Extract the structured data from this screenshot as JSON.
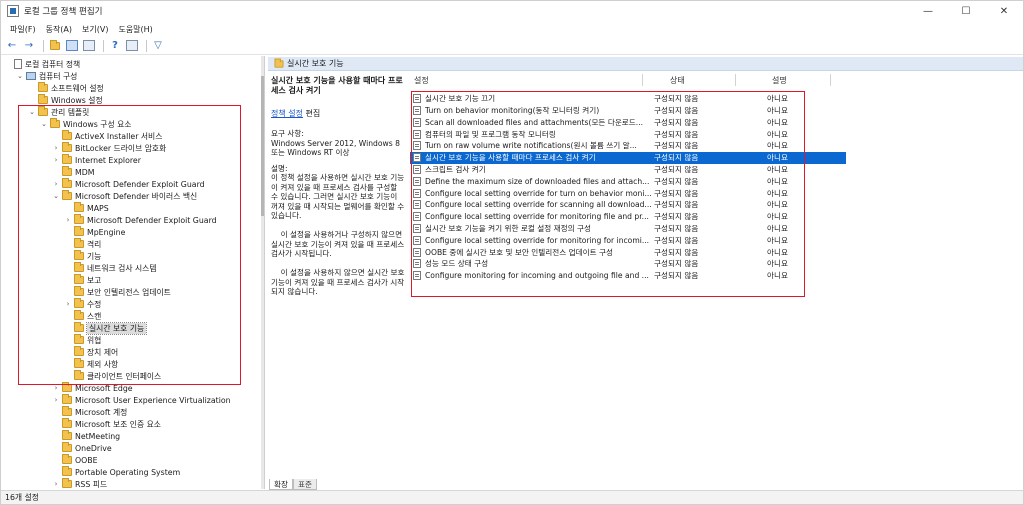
{
  "window": {
    "title": "로컬 그룹 정책 편집기",
    "controls": {
      "minimize": "—",
      "maximize": "☐",
      "close": "✕"
    }
  },
  "menu": [
    "파일(F)",
    "동작(A)",
    "보기(V)",
    "도움말(H)"
  ],
  "toolbar": {
    "icons": [
      "back-arrow-icon",
      "forward-arrow-icon",
      "folder-icon",
      "view-icon",
      "copy-icon",
      "refresh-icon",
      "help-icon",
      "properties-icon",
      "filter-icon"
    ]
  },
  "tree": [
    {
      "label": "로컬 컴퓨터 정책",
      "icon": "doc"
    },
    {
      "label": "컴퓨터 구성",
      "icon": "pc"
    },
    {
      "label": "소프트웨어 설정",
      "icon": "folder"
    },
    {
      "label": "Windows 설정",
      "icon": "folder"
    },
    {
      "label": "관리 템플릿",
      "icon": "folder"
    },
    {
      "label": "Windows 구성 요소",
      "icon": "folder"
    },
    {
      "label": "ActiveX Installer 서비스",
      "icon": "folder"
    },
    {
      "label": "BitLocker 드라이브 암호화",
      "icon": "folder"
    },
    {
      "label": "Internet Explorer",
      "icon": "folder"
    },
    {
      "label": "MDM",
      "icon": "folder"
    },
    {
      "label": "Microsoft Defender Exploit Guard",
      "icon": "folder"
    },
    {
      "label": "Microsoft Defender 바이러스 백신",
      "icon": "folder"
    },
    {
      "label": "MAPS",
      "icon": "folder"
    },
    {
      "label": "Microsoft Defender Exploit Guard",
      "icon": "folder"
    },
    {
      "label": "MpEngine",
      "icon": "folder"
    },
    {
      "label": "격리",
      "icon": "folder"
    },
    {
      "label": "기능",
      "icon": "folder"
    },
    {
      "label": "네트워크 검사 시스템",
      "icon": "folder"
    },
    {
      "label": "보고",
      "icon": "folder"
    },
    {
      "label": "보안 인텔리전스 업데이트",
      "icon": "folder"
    },
    {
      "label": "수정",
      "icon": "folder"
    },
    {
      "label": "스캔",
      "icon": "folder"
    },
    {
      "label": "실시간 보호 기능",
      "icon": "folder"
    },
    {
      "label": "위협",
      "icon": "folder"
    },
    {
      "label": "장치 제어",
      "icon": "folder"
    },
    {
      "label": "제외 사항",
      "icon": "folder"
    },
    {
      "label": "클라이언트 인터페이스",
      "icon": "folder"
    },
    {
      "label": "Microsoft Edge",
      "icon": "folder"
    },
    {
      "label": "Microsoft User Experience Virtualization",
      "icon": "folder"
    },
    {
      "label": "Microsoft 계정",
      "icon": "folder"
    },
    {
      "label": "Microsoft 보조 인증 요소",
      "icon": "folder"
    },
    {
      "label": "NetMeeting",
      "icon": "folder"
    },
    {
      "label": "OneDrive",
      "icon": "folder"
    },
    {
      "label": "OOBE",
      "icon": "folder"
    },
    {
      "label": "Portable Operating System",
      "icon": "folder"
    },
    {
      "label": "RSS 피드",
      "icon": "folder"
    }
  ],
  "right_header": "실시간 보호 기능",
  "description": {
    "title": "실시간 보호 기능을 사용할 때마다 프로세스 검사 켜기",
    "link": "정책 설정",
    "link_suffix": " 편집",
    "requirements": "요구 사항:\nWindows Server 2012, Windows 8 또는 Windows RT 이상",
    "body": "설명:\n이 정책 설정을 사용하면 실시간 보호 기능이 켜져 있을 때 프로세스 검사를 구성할 수 있습니다. 그러면 실시간 보호 기능이 꺼져 있을 때 시작되는 멀웨어를 확인할 수 있습니다.\n\n    이 설정을 사용하거나 구성하지 않으면 실시간 보호 기능이 켜져 있을 때 프로세스 검사가 시작됩니다.\n\n    이 설정을 사용하지 않으면 실시간 보호 기능이 켜져 있을 때 프로세스 검사가 시작되지 않습니다."
  },
  "columns": {
    "setting": "설정",
    "state": "상태",
    "comment": "설명"
  },
  "settings": [
    {
      "name": "실시간 보호 기능 끄기",
      "state": "구성되지 않음",
      "comment": "아니요"
    },
    {
      "name": "Turn on behavior monitoring(동작 모니터링 켜기)",
      "state": "구성되지 않음",
      "comment": "아니요"
    },
    {
      "name": "Scan all downloaded files and attachments(모든 다운로드...",
      "state": "구성되지 않음",
      "comment": "아니요"
    },
    {
      "name": "컴퓨터의 파일 및 프로그램 동작 모니터링",
      "state": "구성되지 않음",
      "comment": "아니요"
    },
    {
      "name": "Turn on raw volume write notifications(원시 볼륨 쓰기 알...",
      "state": "구성되지 않음",
      "comment": "아니요"
    },
    {
      "name": "실시간 보호 기능을 사용할 때마다 프로세스 검사 켜기",
      "state": "구성되지 않음",
      "comment": "아니요"
    },
    {
      "name": "스크립트 검사 켜기",
      "state": "구성되지 않음",
      "comment": "아니요"
    },
    {
      "name": "Define the maximum size of downloaded files and attach...",
      "state": "구성되지 않음",
      "comment": "아니요"
    },
    {
      "name": "Configure local setting override for turn on behavior moni...",
      "state": "구성되지 않음",
      "comment": "아니요"
    },
    {
      "name": "Configure local setting override for scanning all download...",
      "state": "구성되지 않음",
      "comment": "아니요"
    },
    {
      "name": "Configure local setting override for monitoring file and pr...",
      "state": "구성되지 않음",
      "comment": "아니요"
    },
    {
      "name": "실시간 보호 기능을 켜기 위한 로컬 설정 재정의 구성",
      "state": "구성되지 않음",
      "comment": "아니요"
    },
    {
      "name": "Configure local setting override for monitoring for incomi...",
      "state": "구성되지 않음",
      "comment": "아니요"
    },
    {
      "name": "OOBE 중에 실시간 보호 및 보안 인텔리전스 업데이트 구성",
      "state": "구성되지 않음",
      "comment": "아니요"
    },
    {
      "name": "성능 모드 상태 구성",
      "state": "구성되지 않음",
      "comment": "아니요"
    },
    {
      "name": "Configure monitoring for incoming and outgoing file and ...",
      "state": "구성되지 않음",
      "comment": "아니요"
    }
  ],
  "tabs": [
    "확장",
    "표준"
  ],
  "status": "16개 설정",
  "colors": {
    "selection": "#0a68d0",
    "highlight_box": "#e0162b",
    "header_band": "#dfe9f6"
  }
}
